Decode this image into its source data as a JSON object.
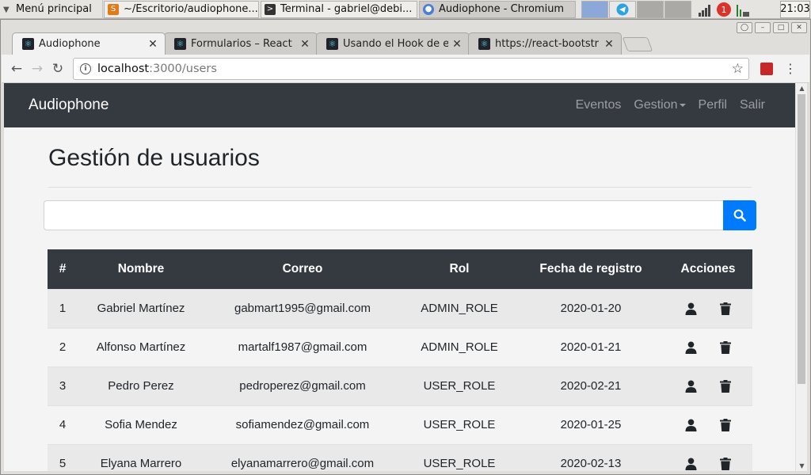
{
  "taskbar": {
    "menu_label": "Menú principal",
    "tasks": [
      {
        "label": "~/Escritorio/audiophone...",
        "icon": "sublime-text-icon"
      },
      {
        "label": "Terminal - gabriel@debi...",
        "icon": "terminal-icon"
      },
      {
        "label": "Audiophone - Chromium",
        "icon": "chromium-icon"
      }
    ],
    "tray_badge": "1",
    "clock": "21:03"
  },
  "browser": {
    "tabs": [
      {
        "title": "Audiophone",
        "icon": "react-icon"
      },
      {
        "title": "Formularios – React",
        "icon": "react-icon"
      },
      {
        "title": "Usando el Hook de e",
        "icon": "react-icon"
      },
      {
        "title": "https://react-bootstr",
        "icon": "react-icon"
      }
    ],
    "url_host": "localhost",
    "url_path": ":3000/users"
  },
  "app": {
    "brand": "Audiophone",
    "nav": {
      "eventos": "Eventos",
      "gestion": "Gestion",
      "perfil": "Perfil",
      "salir": "Salir"
    },
    "page_title": "Gestión de usuarios",
    "search": {
      "value": "",
      "placeholder": ""
    },
    "table": {
      "headers": {
        "num": "#",
        "name": "Nombre",
        "email": "Correo",
        "role": "Rol",
        "date": "Fecha de registro",
        "actions": "Acciones"
      },
      "rows": [
        {
          "num": "1",
          "name": "Gabriel Martínez",
          "email": "gabmart1995@gmail.com",
          "role": "ADMIN_ROLE",
          "date": "2020-01-20"
        },
        {
          "num": "2",
          "name": "Alfonso Martínez",
          "email": "martalf1987@gmail.com",
          "role": "ADMIN_ROLE",
          "date": "2020-01-21"
        },
        {
          "num": "3",
          "name": "Pedro Perez",
          "email": "pedroperez@gmail.com",
          "role": "USER_ROLE",
          "date": "2020-02-21"
        },
        {
          "num": "4",
          "name": "Sofia Mendez",
          "email": "sofiamendez@gmail.com",
          "role": "USER_ROLE",
          "date": "2020-01-25"
        },
        {
          "num": "5",
          "name": "Elyana Marrero",
          "email": "elyanamarrero@gmail.com",
          "role": "USER_ROLE",
          "date": "2020-02-13"
        }
      ]
    }
  },
  "colors": {
    "navbar_bg": "#343a40",
    "primary": "#007bff",
    "row_stripe": "#e9e9e9"
  }
}
